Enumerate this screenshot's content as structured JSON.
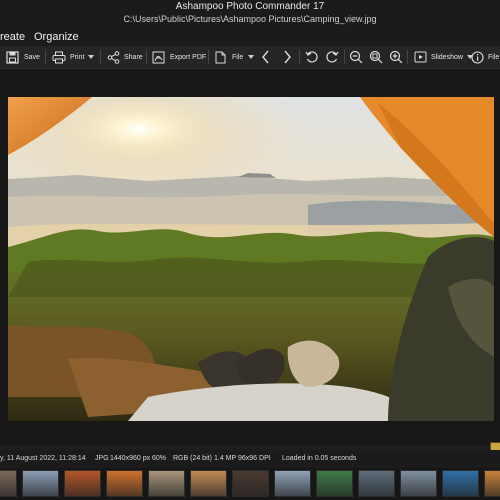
{
  "window": {
    "title": "Ashampoo Photo Commander 17",
    "path": "C:\\Users\\Public\\Pictures\\Ashampoo Pictures\\Camping_view.jpg"
  },
  "menu": {
    "items": [
      "reate",
      "Organize"
    ]
  },
  "toolbar": {
    "save_label": "Save",
    "print_label": "Print",
    "share_label": "Share",
    "export_pdf_label": "Export PDF",
    "file_label": "File",
    "slideshow_label": "Slideshow",
    "file2_label": "File"
  },
  "status": {
    "date": "y, 11 August 2022, 11:28:14",
    "format": "JPG",
    "dimensions": "1440x960 px",
    "zoom": "60%",
    "color": "RGB (24 bit)",
    "megapixels": "1.4 MP",
    "dpi": "96x96 DPI",
    "load_time": "Loaded in 0.05 seconds"
  },
  "filmstrip": {
    "thumbnail_colors": [
      "#7a6a5a",
      "#8a9db5",
      "#b5562a",
      "#d0702d",
      "#a8947a",
      "#c08a55",
      "#4a3a30",
      "#8fa2b8",
      "#3f7a48",
      "#5f6e7c",
      "#7f8fa0",
      "#2f6fa6",
      "#c8823a"
    ]
  }
}
